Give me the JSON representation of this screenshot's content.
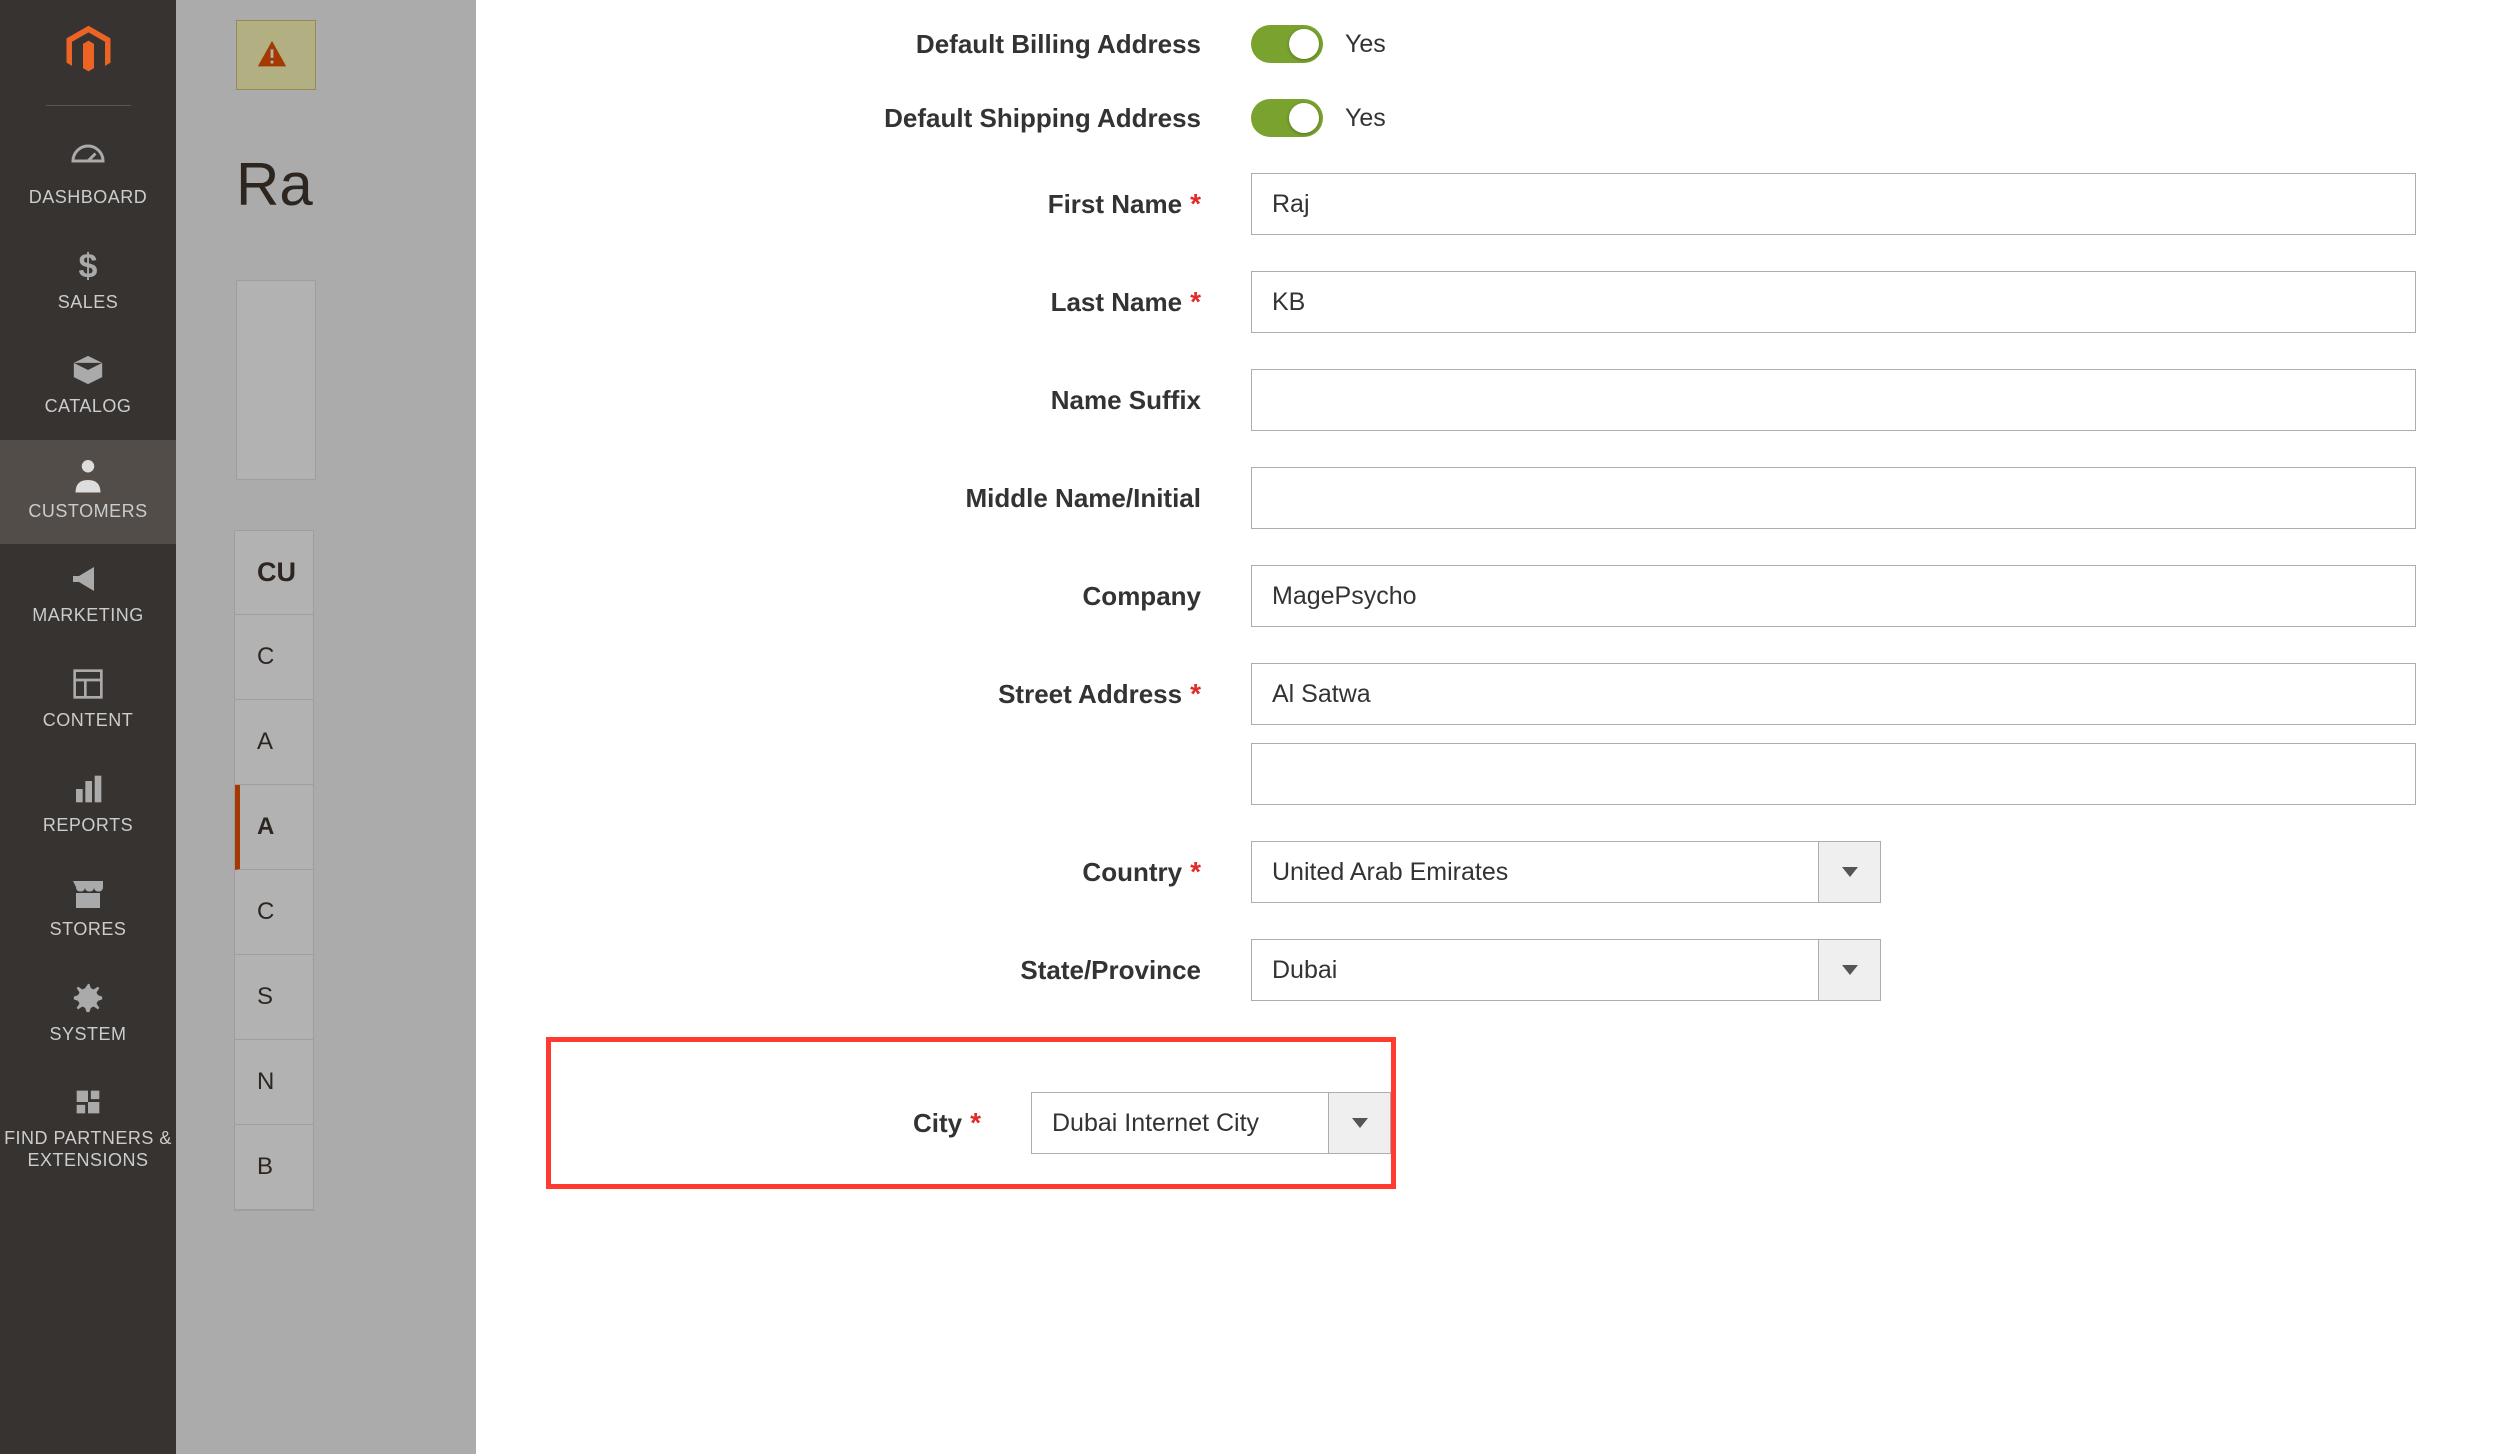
{
  "sidebar": {
    "items": [
      {
        "label": "DASHBOARD",
        "icon": "gauge-icon"
      },
      {
        "label": "SALES",
        "icon": "dollar-icon"
      },
      {
        "label": "CATALOG",
        "icon": "box-icon"
      },
      {
        "label": "CUSTOMERS",
        "icon": "person-icon"
      },
      {
        "label": "MARKETING",
        "icon": "megaphone-icon"
      },
      {
        "label": "CONTENT",
        "icon": "layout-icon"
      },
      {
        "label": "REPORTS",
        "icon": "bars-icon"
      },
      {
        "label": "STORES",
        "icon": "storefront-icon"
      },
      {
        "label": "SYSTEM",
        "icon": "gear-icon"
      },
      {
        "label": "FIND PARTNERS & EXTENSIONS",
        "icon": "partners-icon"
      }
    ]
  },
  "background": {
    "title_partial": "Ra",
    "tab_header": "CU",
    "tabs": [
      "C",
      "A",
      "A",
      "C",
      "S",
      "N",
      "B"
    ]
  },
  "form": {
    "default_billing": {
      "label": "Default Billing Address",
      "value_text": "Yes"
    },
    "default_shipping": {
      "label": "Default Shipping Address",
      "value_text": "Yes"
    },
    "first_name": {
      "label": "First Name",
      "value": "Raj"
    },
    "last_name": {
      "label": "Last Name",
      "value": "KB"
    },
    "name_suffix": {
      "label": "Name Suffix",
      "value": ""
    },
    "middle_name": {
      "label": "Middle Name/Initial",
      "value": ""
    },
    "company": {
      "label": "Company",
      "value": "MagePsycho"
    },
    "street_address": {
      "label": "Street Address",
      "value1": "Al Satwa",
      "value2": ""
    },
    "country": {
      "label": "Country",
      "value": "United Arab Emirates"
    },
    "state": {
      "label": "State/Province",
      "value": "Dubai"
    },
    "city": {
      "label": "City",
      "value": "Dubai Internet City"
    }
  }
}
